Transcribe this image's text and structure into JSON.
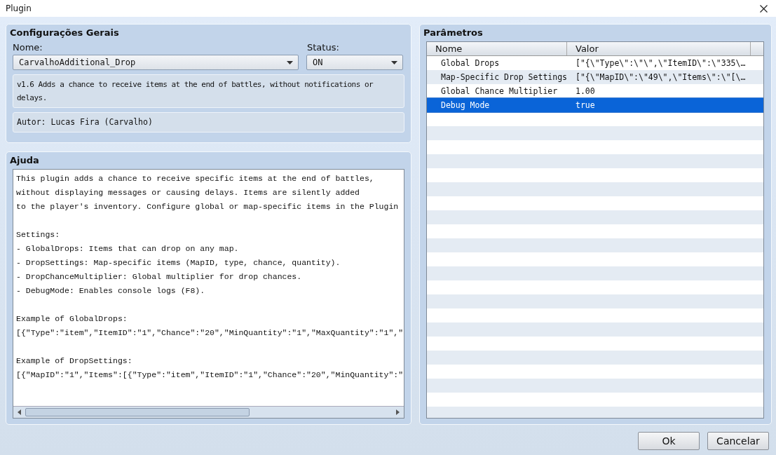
{
  "window": {
    "title": "Plugin"
  },
  "general": {
    "title": "Configurações Gerais",
    "name_label": "Nome:",
    "name_value": "CarvalhoAdditional_Drop",
    "status_label": "Status:",
    "status_value": "ON",
    "description": "v1.6 Adds a chance to receive items at the end of battles, without notifications or delays.",
    "author": "Autor: Lucas Fira (Carvalho)"
  },
  "help": {
    "title": "Ajuda",
    "paragraphs": [
      [
        "This plugin adds a chance to receive specific items at the end of battles,",
        "without displaying messages or causing delays. Items are silently added",
        "to the player's inventory. Configure global or map-specific items in the Plugin"
      ],
      [
        "Settings:",
        "- GlobalDrops: Items that can drop on any map.",
        "- DropSettings: Map-specific items (MapID, type, chance, quantity).",
        "- DropChanceMultiplier: Global multiplier for drop chances.",
        "- DebugMode: Enables console logs (F8)."
      ],
      [
        "Example of GlobalDrops:",
        "[{\"Type\":\"item\",\"ItemID\":\"1\",\"Chance\":\"20\",\"MinQuantity\":\"1\",\"MaxQuantity\":\"1\",\""
      ],
      [
        "Example of DropSettings:",
        "[{\"MapID\":\"1\",\"Items\":[{\"Type\":\"item\",\"ItemID\":\"1\",\"Chance\":\"20\",\"MinQuantity\":\""
      ]
    ]
  },
  "params": {
    "title": "Parâmetros",
    "columns": [
      "Nome",
      "Valor"
    ],
    "rows": [
      {
        "name": "Global Drops",
        "value": "[\"{\\\"Type\\\":\\\"\\\",\\\"ItemID\\\":\\\"335\\…",
        "selected": false
      },
      {
        "name": "Map-Specific Drop Settings",
        "value": "[\"{\\\"MapID\\\":\\\"49\\\",\\\"Items\\\":\\\"[\\…",
        "selected": false
      },
      {
        "name": "Global Chance Multiplier",
        "value": "1.00",
        "selected": false
      },
      {
        "name": "Debug Mode",
        "value": "true",
        "selected": true
      }
    ]
  },
  "buttons": [
    "Ok",
    "Cancelar"
  ]
}
